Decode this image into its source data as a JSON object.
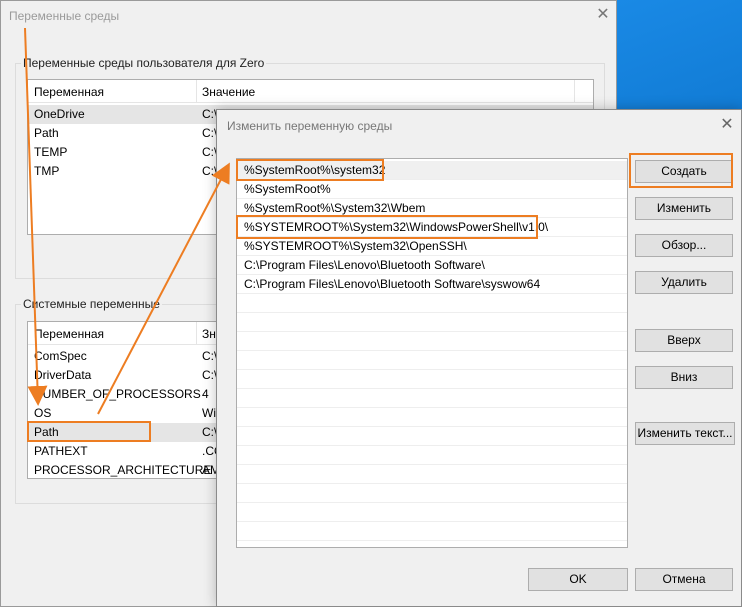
{
  "back_window": {
    "title": "Переменные среды",
    "close_glyph": "✕",
    "user_group": {
      "label": "Переменные среды пользователя для Zero",
      "col_name": "Переменная",
      "col_value": "Значение",
      "rows": [
        {
          "name": "OneDrive",
          "value": "C:\\"
        },
        {
          "name": "Path",
          "value": "C:\\"
        },
        {
          "name": "TEMP",
          "value": "C:\\"
        },
        {
          "name": "TMP",
          "value": "C:\\"
        }
      ]
    },
    "system_group": {
      "label": "Системные переменные",
      "col_name": "Переменная",
      "col_value": "Зн",
      "rows": [
        {
          "name": "ComSpec",
          "value": "C:\\"
        },
        {
          "name": "DriverData",
          "value": "C:\\"
        },
        {
          "name": "NUMBER_OF_PROCESSORS",
          "value": "4"
        },
        {
          "name": "OS",
          "value": "Wi"
        },
        {
          "name": "Path",
          "value": "C:\\"
        },
        {
          "name": "PATHEXT",
          "value": ".CO"
        },
        {
          "name": "PROCESSOR_ARCHITECTURE",
          "value": "AM"
        }
      ]
    }
  },
  "edit_dialog": {
    "title": "Изменить переменную среды",
    "close_glyph": "✕",
    "paths": [
      "%SystemRoot%\\system32",
      "%SystemRoot%",
      "%SystemRoot%\\System32\\Wbem",
      "%SYSTEMROOT%\\System32\\WindowsPowerShell\\v1.0\\",
      "%SYSTEMROOT%\\System32\\OpenSSH\\",
      "C:\\Program Files\\Lenovo\\Bluetooth Software\\",
      "C:\\Program Files\\Lenovo\\Bluetooth Software\\syswow64"
    ],
    "buttons": {
      "create": "Создать",
      "edit": "Изменить",
      "browse": "Обзор...",
      "delete": "Удалить",
      "up": "Вверх",
      "down": "Вниз",
      "edit_text": "Изменить текст...",
      "ok": "OK",
      "cancel": "Отмена"
    }
  },
  "colors": {
    "highlight": "#ed7d22",
    "desktop": "#0a78d4"
  }
}
